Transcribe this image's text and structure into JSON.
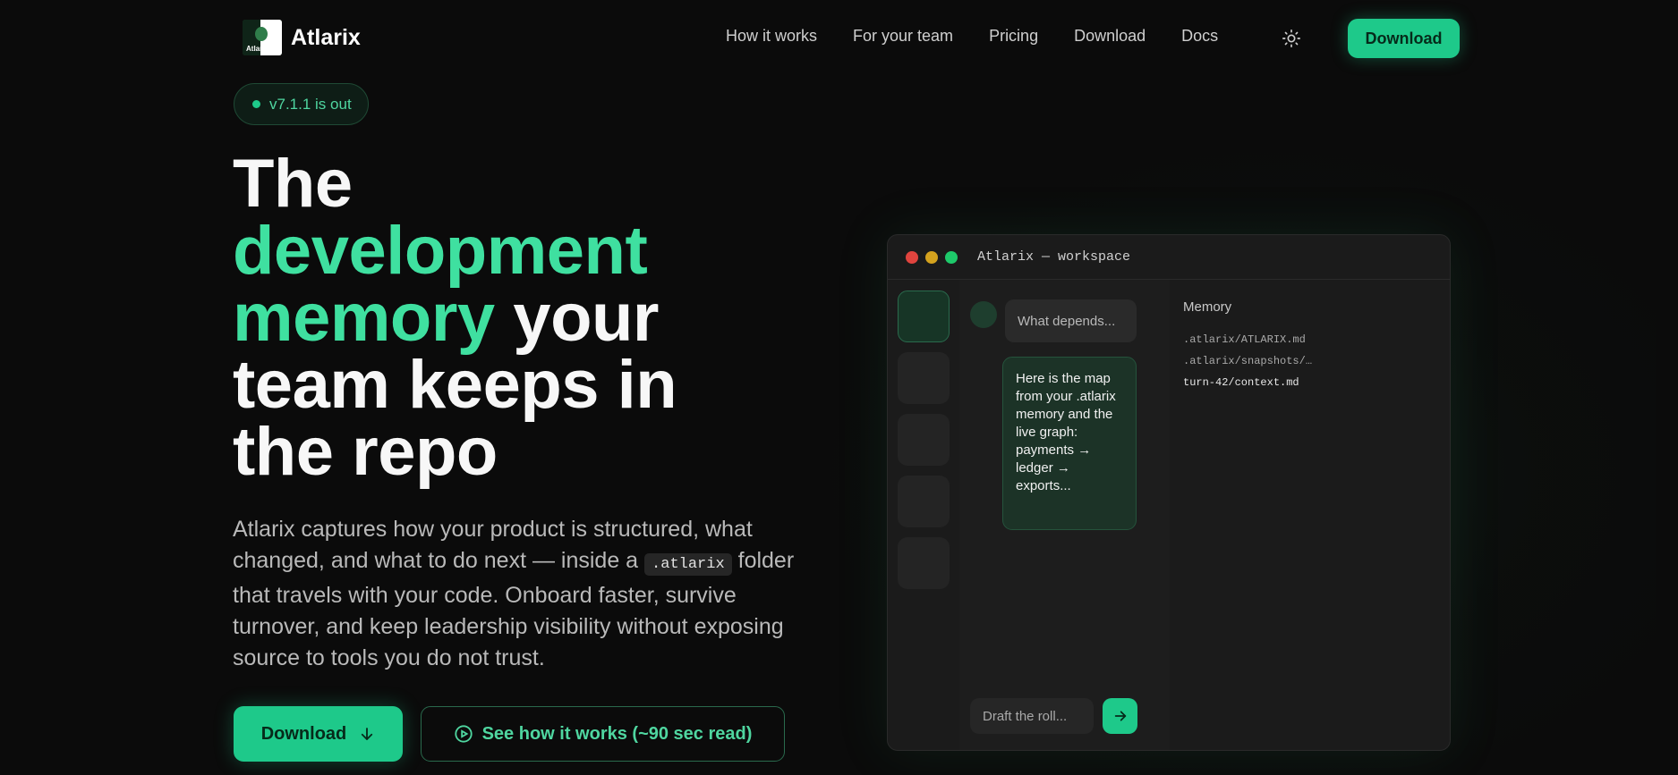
{
  "brand": {
    "name": "Atlarix",
    "logo_text": "Atlarix"
  },
  "nav": {
    "links": [
      "How it works",
      "For your team",
      "Pricing",
      "Download",
      "Docs"
    ],
    "theme_icon": "sun-icon",
    "download_label": "Download"
  },
  "badge": {
    "text": "v7.1.1 is out"
  },
  "hero": {
    "title_line1": "The",
    "title_accent": "development memory",
    "title_rest_a": " your",
    "title_rest_b": "team keeps in the repo",
    "desc_before": "Atlarix captures how your product is structured, what changed, and what to do next — inside a ",
    "desc_code": ".atlarix",
    "desc_after": " folder that travels with your code. Onboard faster, survive turnover, and keep leadership visibility without exposing source to tools you do not trust.",
    "cta_primary": "Download",
    "cta_secondary": "See how it works (~90 sec read)"
  },
  "workspace": {
    "title": "Atlarix — workspace",
    "user_message": "What depends...",
    "reply_message": "Here is the map from your .atlarix memory and the live graph: payments → ledger → exports...",
    "input_placeholder": "Draft the roll...",
    "memory_title": "Memory",
    "memory_files": [
      ".atlarix/ATLARIX.md",
      ".atlarix/snapshots/…",
      "turn-42/context.md"
    ]
  },
  "colors": {
    "accent": "#1ec98a",
    "accent_text": "#3fe0a0",
    "background": "#0b0b0b"
  }
}
